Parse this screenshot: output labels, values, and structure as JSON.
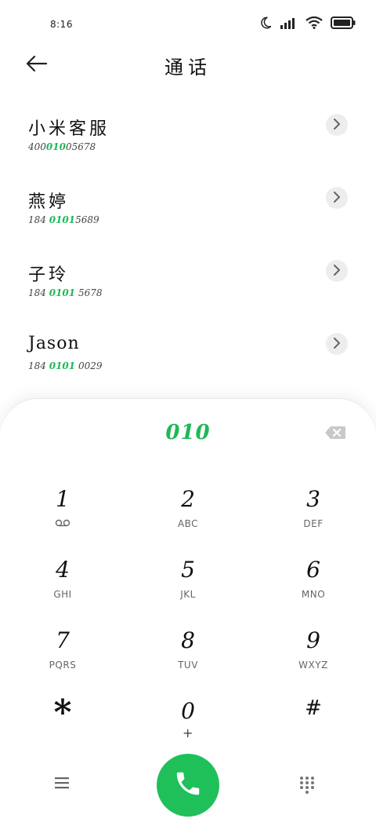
{
  "status": {
    "time": "8:16"
  },
  "header": {
    "title": "通话"
  },
  "contacts": [
    {
      "name": "小米客服",
      "number_pre": "400",
      "number_hl": "010",
      "number_post": "05678"
    },
    {
      "name": "燕婷",
      "number_pre": "184 ",
      "number_hl": "0101",
      "number_post": "5689"
    },
    {
      "name": "子玲",
      "number_pre": "184 ",
      "number_hl": "0101",
      "number_post": " 5678"
    },
    {
      "name": "Jason",
      "number_pre": "184 ",
      "number_hl": "0101",
      "number_post": " 0029"
    }
  ],
  "dialpad": {
    "typed": "010",
    "keys": [
      {
        "digit": "1",
        "letters": ""
      },
      {
        "digit": "2",
        "letters": "ABC"
      },
      {
        "digit": "3",
        "letters": "DEF"
      },
      {
        "digit": "4",
        "letters": "GHI"
      },
      {
        "digit": "5",
        "letters": "JKL"
      },
      {
        "digit": "6",
        "letters": "MNO"
      },
      {
        "digit": "7",
        "letters": "PQRS"
      },
      {
        "digit": "8",
        "letters": "TUV"
      },
      {
        "digit": "9",
        "letters": "WXYZ"
      },
      {
        "digit": "*",
        "letters": ""
      },
      {
        "digit": "0",
        "letters": "+"
      },
      {
        "digit": "#",
        "letters": ""
      }
    ]
  },
  "colors": {
    "accent": "#1fb857",
    "call": "#1fc05a",
    "chip": "#ededed"
  },
  "icons": [
    "moon-icon",
    "signal-icon",
    "wifi-icon",
    "battery-icon",
    "back-arrow-icon",
    "chevron-right-icon",
    "backspace-icon",
    "voicemail-icon",
    "menu-icon",
    "phone-icon",
    "dialpad-icon"
  ]
}
